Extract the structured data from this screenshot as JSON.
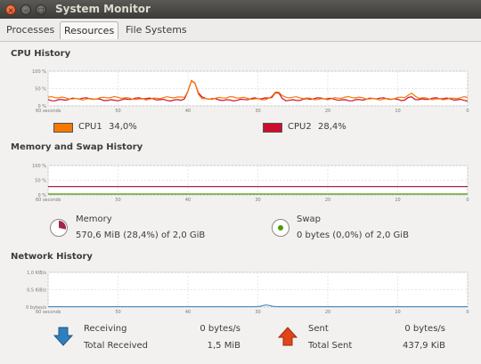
{
  "window": {
    "title": "System Monitor"
  },
  "tabs": [
    {
      "label": "Processes",
      "active": false
    },
    {
      "label": "Resources",
      "active": true
    },
    {
      "label": "File Systems",
      "active": false
    }
  ],
  "cpu": {
    "title": "CPU History",
    "y_ticks": [
      "100 %",
      "50 %",
      "0 %"
    ],
    "x_ticks": [
      "60 seconds",
      "50",
      "40",
      "30",
      "20",
      "10",
      "0"
    ],
    "series": [
      {
        "label": "CPU1",
        "value": "34,0%",
        "color": "#f57900"
      },
      {
        "label": "CPU2",
        "value": "28,4%",
        "color": "#cc0d2e"
      }
    ]
  },
  "memory": {
    "title": "Memory and Swap History",
    "y_ticks": [
      "100 %",
      "50 %",
      "0 %"
    ],
    "x_ticks": [
      "60 seconds",
      "50",
      "40",
      "30",
      "20",
      "10",
      "0"
    ],
    "memory_label": "Memory",
    "memory_value": "570,6 MiB (28,4%) of 2,0 GiB",
    "memory_fraction": 0.284,
    "memory_color": "#a0264c",
    "swap_label": "Swap",
    "swap_value": "0 bytes (0,0%) of 2,0 GiB",
    "swap_fraction": 0,
    "swap_color": "#4e9a06"
  },
  "network": {
    "title": "Network History",
    "y_ticks": [
      "1,0 KiB/s",
      "0,5 KiB/s",
      "0 bytes/s"
    ],
    "x_ticks": [
      "60 seconds",
      "50",
      "40",
      "30",
      "20",
      "10",
      "0"
    ],
    "receiving_label": "Receiving",
    "receiving_value": "0 bytes/s",
    "total_received_label": "Total Received",
    "total_received_value": "1,5 MiB",
    "sent_label": "Sent",
    "sent_value": "0 bytes/s",
    "total_sent_label": "Total Sent",
    "total_sent_value": "437,9 KiB",
    "receiving_color": "#2f7fbf",
    "sent_color": "#e0451b"
  },
  "icons": {
    "close": "close-icon",
    "minimize": "minimize-icon",
    "maximize": "maximize-icon",
    "receive": "download-arrow-icon",
    "send": "upload-arrow-icon"
  }
}
